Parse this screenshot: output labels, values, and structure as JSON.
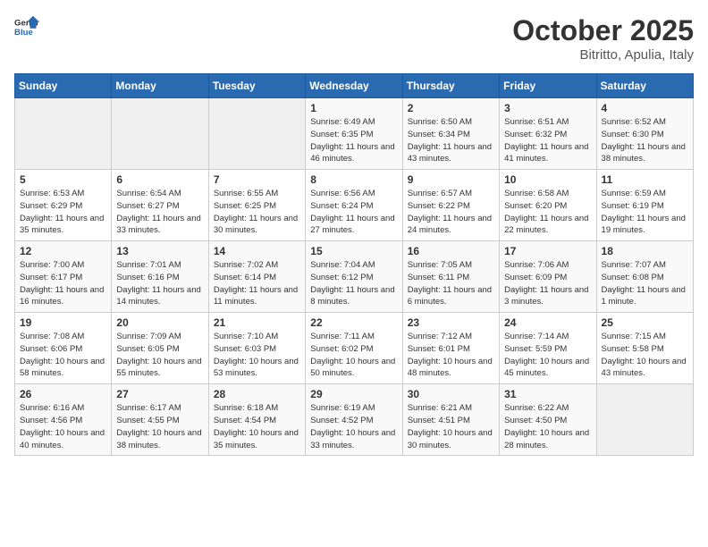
{
  "header": {
    "logo_general": "General",
    "logo_blue": "Blue",
    "month": "October 2025",
    "location": "Bitritto, Apulia, Italy"
  },
  "weekdays": [
    "Sunday",
    "Monday",
    "Tuesday",
    "Wednesday",
    "Thursday",
    "Friday",
    "Saturday"
  ],
  "weeks": [
    [
      {
        "day": "",
        "sunrise": "",
        "sunset": "",
        "daylight": ""
      },
      {
        "day": "",
        "sunrise": "",
        "sunset": "",
        "daylight": ""
      },
      {
        "day": "",
        "sunrise": "",
        "sunset": "",
        "daylight": ""
      },
      {
        "day": "1",
        "sunrise": "Sunrise: 6:49 AM",
        "sunset": "Sunset: 6:35 PM",
        "daylight": "Daylight: 11 hours and 46 minutes."
      },
      {
        "day": "2",
        "sunrise": "Sunrise: 6:50 AM",
        "sunset": "Sunset: 6:34 PM",
        "daylight": "Daylight: 11 hours and 43 minutes."
      },
      {
        "day": "3",
        "sunrise": "Sunrise: 6:51 AM",
        "sunset": "Sunset: 6:32 PM",
        "daylight": "Daylight: 11 hours and 41 minutes."
      },
      {
        "day": "4",
        "sunrise": "Sunrise: 6:52 AM",
        "sunset": "Sunset: 6:30 PM",
        "daylight": "Daylight: 11 hours and 38 minutes."
      }
    ],
    [
      {
        "day": "5",
        "sunrise": "Sunrise: 6:53 AM",
        "sunset": "Sunset: 6:29 PM",
        "daylight": "Daylight: 11 hours and 35 minutes."
      },
      {
        "day": "6",
        "sunrise": "Sunrise: 6:54 AM",
        "sunset": "Sunset: 6:27 PM",
        "daylight": "Daylight: 11 hours and 33 minutes."
      },
      {
        "day": "7",
        "sunrise": "Sunrise: 6:55 AM",
        "sunset": "Sunset: 6:25 PM",
        "daylight": "Daylight: 11 hours and 30 minutes."
      },
      {
        "day": "8",
        "sunrise": "Sunrise: 6:56 AM",
        "sunset": "Sunset: 6:24 PM",
        "daylight": "Daylight: 11 hours and 27 minutes."
      },
      {
        "day": "9",
        "sunrise": "Sunrise: 6:57 AM",
        "sunset": "Sunset: 6:22 PM",
        "daylight": "Daylight: 11 hours and 24 minutes."
      },
      {
        "day": "10",
        "sunrise": "Sunrise: 6:58 AM",
        "sunset": "Sunset: 6:20 PM",
        "daylight": "Daylight: 11 hours and 22 minutes."
      },
      {
        "day": "11",
        "sunrise": "Sunrise: 6:59 AM",
        "sunset": "Sunset: 6:19 PM",
        "daylight": "Daylight: 11 hours and 19 minutes."
      }
    ],
    [
      {
        "day": "12",
        "sunrise": "Sunrise: 7:00 AM",
        "sunset": "Sunset: 6:17 PM",
        "daylight": "Daylight: 11 hours and 16 minutes."
      },
      {
        "day": "13",
        "sunrise": "Sunrise: 7:01 AM",
        "sunset": "Sunset: 6:16 PM",
        "daylight": "Daylight: 11 hours and 14 minutes."
      },
      {
        "day": "14",
        "sunrise": "Sunrise: 7:02 AM",
        "sunset": "Sunset: 6:14 PM",
        "daylight": "Daylight: 11 hours and 11 minutes."
      },
      {
        "day": "15",
        "sunrise": "Sunrise: 7:04 AM",
        "sunset": "Sunset: 6:12 PM",
        "daylight": "Daylight: 11 hours and 8 minutes."
      },
      {
        "day": "16",
        "sunrise": "Sunrise: 7:05 AM",
        "sunset": "Sunset: 6:11 PM",
        "daylight": "Daylight: 11 hours and 6 minutes."
      },
      {
        "day": "17",
        "sunrise": "Sunrise: 7:06 AM",
        "sunset": "Sunset: 6:09 PM",
        "daylight": "Daylight: 11 hours and 3 minutes."
      },
      {
        "day": "18",
        "sunrise": "Sunrise: 7:07 AM",
        "sunset": "Sunset: 6:08 PM",
        "daylight": "Daylight: 11 hours and 1 minute."
      }
    ],
    [
      {
        "day": "19",
        "sunrise": "Sunrise: 7:08 AM",
        "sunset": "Sunset: 6:06 PM",
        "daylight": "Daylight: 10 hours and 58 minutes."
      },
      {
        "day": "20",
        "sunrise": "Sunrise: 7:09 AM",
        "sunset": "Sunset: 6:05 PM",
        "daylight": "Daylight: 10 hours and 55 minutes."
      },
      {
        "day": "21",
        "sunrise": "Sunrise: 7:10 AM",
        "sunset": "Sunset: 6:03 PM",
        "daylight": "Daylight: 10 hours and 53 minutes."
      },
      {
        "day": "22",
        "sunrise": "Sunrise: 7:11 AM",
        "sunset": "Sunset: 6:02 PM",
        "daylight": "Daylight: 10 hours and 50 minutes."
      },
      {
        "day": "23",
        "sunrise": "Sunrise: 7:12 AM",
        "sunset": "Sunset: 6:01 PM",
        "daylight": "Daylight: 10 hours and 48 minutes."
      },
      {
        "day": "24",
        "sunrise": "Sunrise: 7:14 AM",
        "sunset": "Sunset: 5:59 PM",
        "daylight": "Daylight: 10 hours and 45 minutes."
      },
      {
        "day": "25",
        "sunrise": "Sunrise: 7:15 AM",
        "sunset": "Sunset: 5:58 PM",
        "daylight": "Daylight: 10 hours and 43 minutes."
      }
    ],
    [
      {
        "day": "26",
        "sunrise": "Sunrise: 6:16 AM",
        "sunset": "Sunset: 4:56 PM",
        "daylight": "Daylight: 10 hours and 40 minutes."
      },
      {
        "day": "27",
        "sunrise": "Sunrise: 6:17 AM",
        "sunset": "Sunset: 4:55 PM",
        "daylight": "Daylight: 10 hours and 38 minutes."
      },
      {
        "day": "28",
        "sunrise": "Sunrise: 6:18 AM",
        "sunset": "Sunset: 4:54 PM",
        "daylight": "Daylight: 10 hours and 35 minutes."
      },
      {
        "day": "29",
        "sunrise": "Sunrise: 6:19 AM",
        "sunset": "Sunset: 4:52 PM",
        "daylight": "Daylight: 10 hours and 33 minutes."
      },
      {
        "day": "30",
        "sunrise": "Sunrise: 6:21 AM",
        "sunset": "Sunset: 4:51 PM",
        "daylight": "Daylight: 10 hours and 30 minutes."
      },
      {
        "day": "31",
        "sunrise": "Sunrise: 6:22 AM",
        "sunset": "Sunset: 4:50 PM",
        "daylight": "Daylight: 10 hours and 28 minutes."
      },
      {
        "day": "",
        "sunrise": "",
        "sunset": "",
        "daylight": ""
      }
    ]
  ]
}
